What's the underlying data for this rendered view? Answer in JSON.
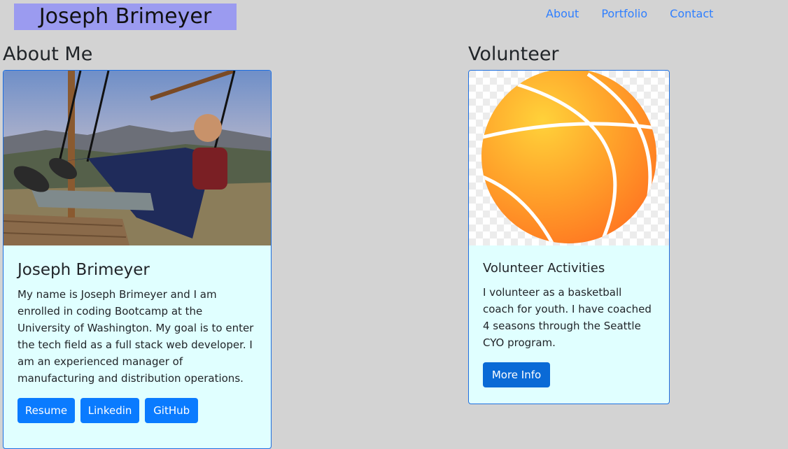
{
  "header": {
    "brand": "Joseph Brimeyer",
    "nav": [
      "About",
      "Portfolio",
      "Contact"
    ]
  },
  "about": {
    "section_title": "About Me",
    "card_title": "Joseph Brimeyer",
    "card_text": "My name is Joseph Brimeyer and I am enrolled in coding Bootcamp at the University of Washington. My goal is to enter the tech field as a full stack web developer. I am an experienced manager of manufacturing and distribution operations.",
    "buttons": [
      "Resume",
      "Linkedin",
      "GitHub"
    ]
  },
  "volunteer": {
    "section_title": "Volunteer",
    "card_title": "Volunteer Activities",
    "card_text": "I volunteer as a basketball coach for youth. I have coached 4 seasons through the Seattle CYO program.",
    "button": "More Info"
  },
  "colors": {
    "background": "#d3d3d3",
    "brand_bg": "#9b9bf0",
    "card_bg": "#e0ffff",
    "link": "#2f7fff",
    "button": "#0a7bff",
    "basketball": "#ff9a2a"
  }
}
